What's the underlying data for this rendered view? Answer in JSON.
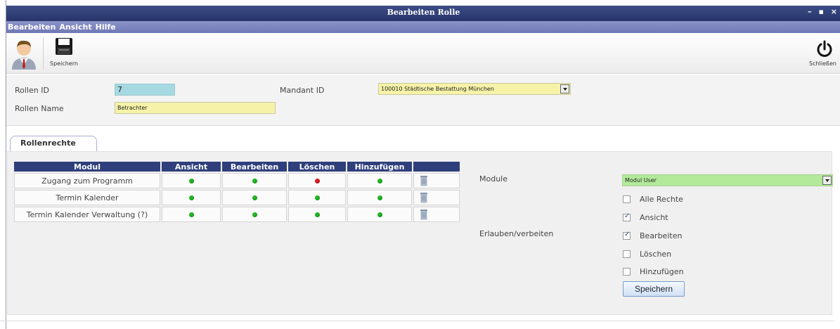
{
  "window": {
    "title": "Bearbeiten Rolle",
    "controls": "– ▪ ×"
  },
  "menu": [
    "Bearbeiten",
    "Ansicht",
    "Hilfe"
  ],
  "toolbar": {
    "save_label": "Speichern",
    "close_label": "Schließen",
    "user_icon": "user-icon",
    "save_icon": "floppy-disk-icon",
    "close_icon": "power-icon"
  },
  "form": {
    "rollen_id_label": "Rollen ID",
    "rollen_id_value": "7",
    "rollen_name_label": "Rollen Name",
    "rollen_name_value": "Betrachter",
    "mandant_id_label": "Mandant ID",
    "mandant_id_value": "100010 Städtische Bestattung München"
  },
  "tab": {
    "label": "Rollenrechte"
  },
  "table": {
    "headers": [
      "Modul",
      "Ansicht",
      "Bearbeiten",
      "Löschen",
      "Hinzufügen",
      ""
    ],
    "rows": [
      {
        "modul": "Zugang zum Programm",
        "ansicht": "green",
        "bearbeiten": "green",
        "loeschen": "red",
        "hinzufuegen": "green"
      },
      {
        "modul": "Termin Kalender",
        "ansicht": "green",
        "bearbeiten": "green",
        "loeschen": "green",
        "hinzufuegen": "green"
      },
      {
        "modul": "Termin Kalender Verwaltung (?)",
        "ansicht": "green",
        "bearbeiten": "green",
        "loeschen": "green",
        "hinzufuegen": "green"
      }
    ]
  },
  "colors": {
    "green": "#22bb22",
    "red": "#e02020"
  },
  "rights": {
    "module_label": "Module",
    "module_value": "Modul User",
    "erlauben_label": "Erlauben/verbeiten",
    "options": [
      {
        "label": "Alle Rechte",
        "checked": false
      },
      {
        "label": "Ansicht",
        "checked": true
      },
      {
        "label": "Bearbeiten",
        "checked": true
      },
      {
        "label": "Löschen",
        "checked": false
      },
      {
        "label": "Hinzufügen",
        "checked": false
      }
    ],
    "save_label": "Speichern"
  }
}
